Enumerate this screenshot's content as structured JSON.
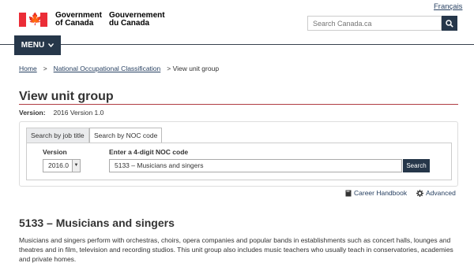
{
  "header": {
    "lang_link": "Français",
    "gov_en": "Government of Canada",
    "gov_fr": "Gouvernement du Canada",
    "search_placeholder": "Search Canada.ca",
    "menu_label": "MENU"
  },
  "breadcrumb": {
    "items": [
      "Home",
      "National Occupational Classification",
      "View unit group"
    ],
    "separator": ">"
  },
  "page": {
    "title": "View unit group",
    "version_label": "Version:",
    "version_value": "2016 Version 1.0"
  },
  "search_panel": {
    "tabs": [
      "Search by job title",
      "Search by NOC code"
    ],
    "active_tab": 1,
    "version_label": "Version",
    "version_value": "2016.0",
    "noc_label": "Enter a 4-digit NOC code",
    "noc_value": "5133 – Musicians and singers",
    "search_button": "Search"
  },
  "links": {
    "career_handbook": "Career Handbook",
    "advanced": "Advanced"
  },
  "unit_group": {
    "title": "5133 – Musicians and singers",
    "description": "Musicians and singers perform with orchestras, choirs, opera companies and popular bands in establishments such as concert halls, lounges and theatres and in film, television and recording studios. This unit group also includes music teachers who usually teach in conservatories, academies and private homes."
  },
  "colors": {
    "brand_dark": "#26374a",
    "link": "#284162",
    "flag_red": "#eb2d37",
    "title_rule": "#af3c43"
  }
}
